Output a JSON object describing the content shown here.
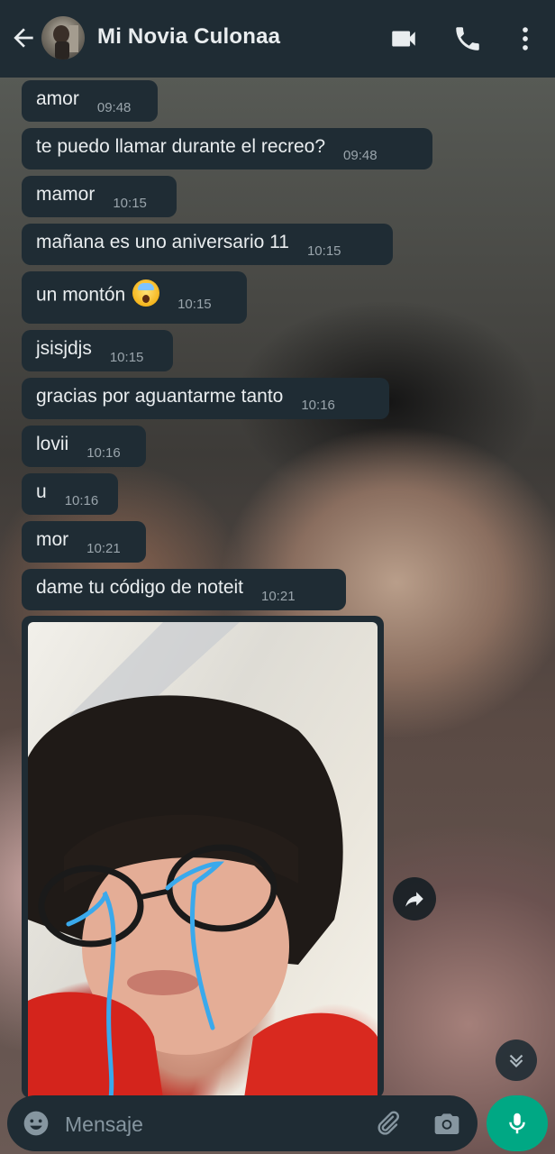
{
  "header": {
    "contact_name": "Mi Novia Culonaa",
    "icons": [
      "back-arrow-icon",
      "video-call-icon",
      "voice-call-icon",
      "more-options-icon"
    ]
  },
  "messages": [
    {
      "text": "amor",
      "time": "09:48"
    },
    {
      "text": "te puedo llamar durante el recreo?",
      "time": "09:48"
    },
    {
      "text": "mamor",
      "time": "10:15"
    },
    {
      "text": "mañana es uno aniversario 11",
      "time": "10:15"
    },
    {
      "text": "un montón",
      "emoji": "face-screaming-in-fear",
      "time": "10:15"
    },
    {
      "text": "jsisjdjs",
      "time": "10:15"
    },
    {
      "text": "gracias por aguantarme tanto",
      "time": "10:16"
    },
    {
      "text": "lovii",
      "time": "10:16"
    },
    {
      "text": "u",
      "time": "10:16"
    },
    {
      "text": "mor",
      "time": "10:21"
    },
    {
      "text": "dame tu código de noteit",
      "time": "10:21"
    }
  ],
  "photo_message": {
    "type": "image",
    "forward_icon": "forward-icon"
  },
  "composer": {
    "placeholder": "Mensaje",
    "icons": [
      "emoji-icon",
      "attach-icon",
      "camera-icon",
      "mic-icon"
    ]
  },
  "colors": {
    "header_bg": "#1f2c34",
    "bubble_bg": "#1f2c34",
    "accent": "#00a884",
    "text": "#e9edef",
    "meta_text": "#9aa5ac"
  }
}
